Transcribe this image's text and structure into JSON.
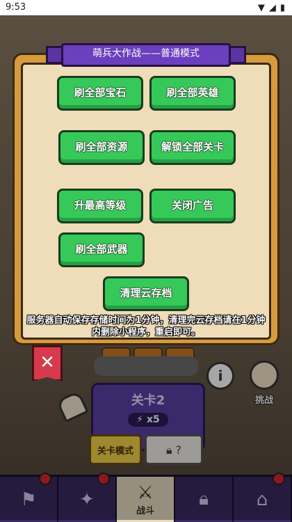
{
  "status_bar": {
    "time": "9:53"
  },
  "dialog": {
    "title": "萌兵大作战——普通模式",
    "buttons": [
      {
        "id": "refresh-gems",
        "label": "刷全部宝石"
      },
      {
        "id": "refresh-heroes",
        "label": "刷全部英雄"
      },
      {
        "id": "refresh-resources",
        "label": "刷全部资源"
      },
      {
        "id": "unlock-levels",
        "label": "解锁全部关卡"
      },
      {
        "id": "max-level",
        "label": "升最高等级"
      },
      {
        "id": "close-ads",
        "label": "关闭广告"
      },
      {
        "id": "refresh-weapons",
        "label": "刷全部武器"
      },
      {
        "id": "clear-cloud-save",
        "label": "清理云存档"
      }
    ],
    "notice": "服务器自动保存存储时间为1分钟，清理完云存档请在1分钟内删除小程序，重启即可。",
    "close_icon": "close-icon"
  },
  "game": {
    "challenge_label": "挑战",
    "info_icon": "info-icon",
    "level_card": {
      "title": "关卡2",
      "cost": "x5"
    },
    "mode_button": "关卡模式",
    "locked_label": "?",
    "tabs": [
      {
        "icon": "map-icon",
        "label": ""
      },
      {
        "icon": "compass-icon",
        "label": ""
      },
      {
        "icon": "swords-icon",
        "label": "战斗"
      },
      {
        "icon": "lock-icon",
        "label": ""
      },
      {
        "icon": "shop-icon",
        "label": ""
      }
    ]
  },
  "colors": {
    "button_green": "#36c95a",
    "ribbon_purple": "#6b3fbd",
    "panel_parchment": "#efdcb8"
  }
}
